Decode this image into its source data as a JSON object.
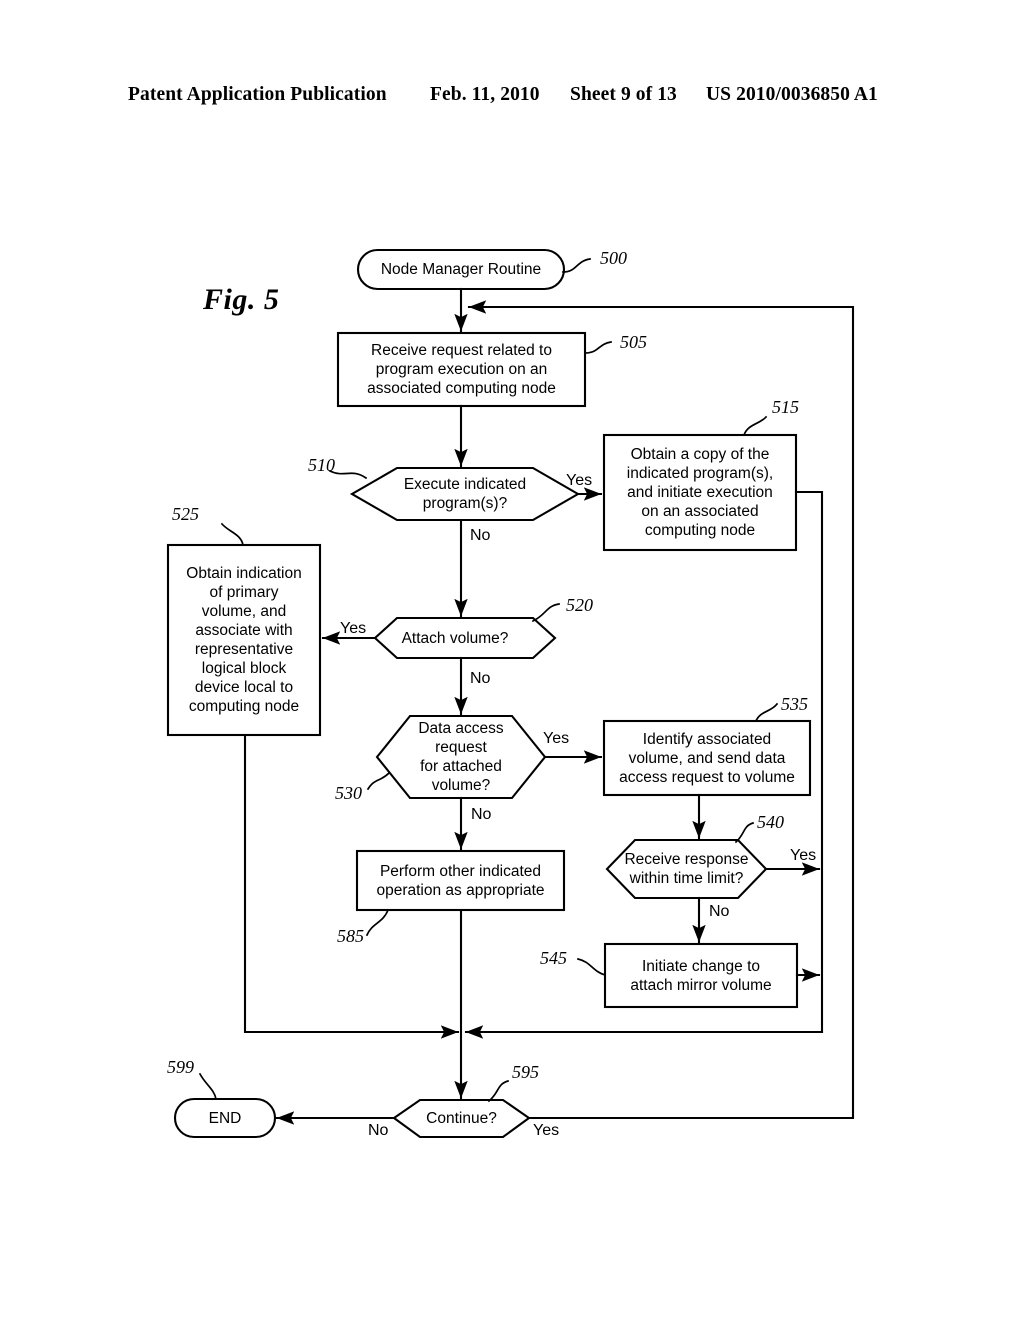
{
  "header": {
    "publication": "Patent Application Publication",
    "date": "Feb. 11, 2010",
    "sheet": "Sheet 9 of 13",
    "number": "US 2010/0036850 A1"
  },
  "figure": {
    "label": "Fig. 5"
  },
  "diagram": {
    "title": "Node Manager Routine flowchart",
    "nodes": [
      {
        "id": "500",
        "ref": "500",
        "shape": "terminator",
        "text": "Node Manager Routine"
      },
      {
        "id": "505",
        "ref": "505",
        "shape": "process",
        "text": "Receive request related to\nprogram execution on an\nassociated computing node"
      },
      {
        "id": "510",
        "ref": "510",
        "shape": "decision",
        "text": "Execute indicated\nprogram(s)?"
      },
      {
        "id": "515",
        "ref": "515",
        "shape": "process",
        "text": "Obtain a copy of the\nindicated program(s),\nand initiate execution\non an associated\ncomputing node"
      },
      {
        "id": "520",
        "ref": "520",
        "shape": "decision",
        "text": "Attach volume?"
      },
      {
        "id": "525",
        "ref": "525",
        "shape": "process",
        "text": "Obtain indication\nof primary\nvolume, and\nassociate with\nrepresentative\nlogical block\ndevice local to\ncomputing node"
      },
      {
        "id": "530",
        "ref": "530",
        "shape": "decision",
        "text": "Data access\nrequest\nfor attached\nvolume?"
      },
      {
        "id": "535",
        "ref": "535",
        "shape": "process",
        "text": "Identify associated\nvolume, and send data\naccess request to volume"
      },
      {
        "id": "540",
        "ref": "540",
        "shape": "decision",
        "text": "Receive response\nwithin time limit?"
      },
      {
        "id": "545",
        "ref": "545",
        "shape": "process",
        "text": "Initiate change to\nattach mirror volume"
      },
      {
        "id": "585",
        "ref": "585",
        "shape": "process",
        "text": "Perform other indicated\noperation as appropriate"
      },
      {
        "id": "595",
        "ref": "595",
        "shape": "decision",
        "text": "Continue?"
      },
      {
        "id": "599",
        "ref": "599",
        "shape": "terminator",
        "text": "END"
      }
    ],
    "edge_labels": {
      "e510_yes": "Yes",
      "e510_no": "No",
      "e520_yes": "Yes",
      "e520_no": "No",
      "e530_yes": "Yes",
      "e530_no": "No",
      "e540_yes": "Yes",
      "e540_no": "No",
      "e595_no": "No",
      "e595_yes": "Yes"
    },
    "stroke_color": "#000000",
    "fill_color": "#ffffff"
  }
}
